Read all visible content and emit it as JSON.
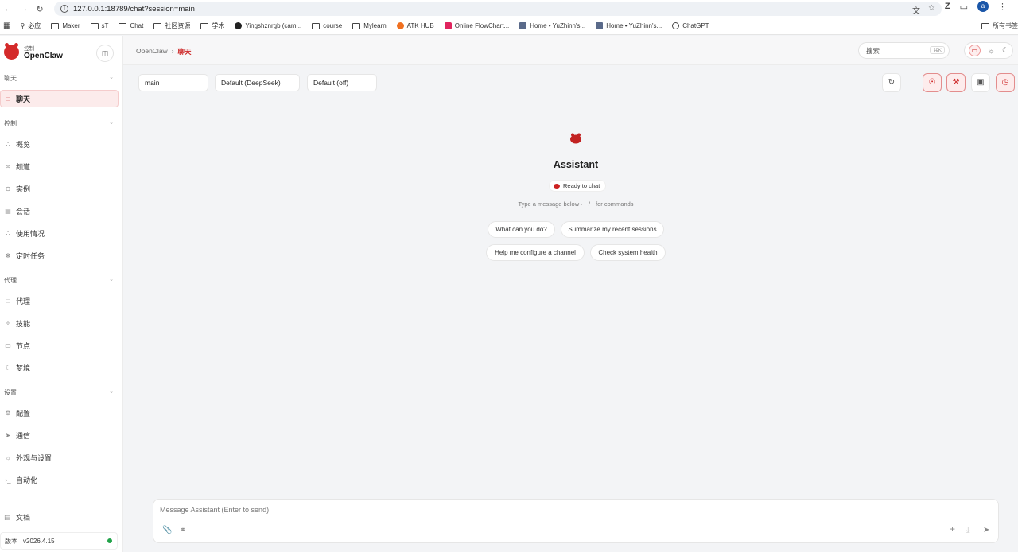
{
  "browser": {
    "url": "127.0.0.1:18789/chat?session=main",
    "bookmarks": [
      {
        "label": "必应",
        "icon": "search-icon"
      },
      {
        "label": "Maker",
        "icon": "folder-icon"
      },
      {
        "label": "sT",
        "icon": "folder-icon"
      },
      {
        "label": "Chat",
        "icon": "folder-icon"
      },
      {
        "label": "社区资源",
        "icon": "folder-icon"
      },
      {
        "label": "学术",
        "icon": "folder-icon"
      },
      {
        "label": "Yingshznrgb (cam...",
        "icon": "github-icon"
      },
      {
        "label": "course",
        "icon": "folder-icon"
      },
      {
        "label": "Mylearn",
        "icon": "folder-icon"
      },
      {
        "label": "ATK HUB",
        "icon": "atk-icon"
      },
      {
        "label": "Online FlowChart...",
        "icon": "flowchart-icon"
      },
      {
        "label": "Home • YuZhinn's...",
        "icon": "site-icon"
      },
      {
        "label": "Home • YuZhinn's...",
        "icon": "site-icon"
      },
      {
        "label": "ChatGPT",
        "icon": "chatgpt-icon"
      }
    ],
    "all_bookmarks": "所有书签",
    "profile_initial": "a"
  },
  "sidebar": {
    "brand_sub": "控制",
    "brand_name": "OpenClaw",
    "sections": {
      "chat": "聊天",
      "control": "控制",
      "agent": "代理",
      "settings": "设置"
    },
    "items": {
      "chat": "聊天",
      "overview": "概览",
      "channels": "频道",
      "instances": "实例",
      "sessions": "会话",
      "usage": "使用情况",
      "cron": "定时任务",
      "agents": "代理",
      "skills": "技能",
      "nodes": "节点",
      "dreams": "梦境",
      "config": "配置",
      "comms": "通信",
      "appearance": "外观与设置",
      "automation": "自动化"
    },
    "docs": "文档",
    "version_label": "版本",
    "version_value": "v2026.4.15"
  },
  "topbar": {
    "breadcrumb_root": "OpenClaw",
    "breadcrumb_current": "聊天",
    "search_placeholder": "搜索",
    "search_shortcut": "⌘K"
  },
  "chat": {
    "session": "main",
    "model": "Default (DeepSeek)",
    "thinking": "Default (off)",
    "assistant_name": "Assistant",
    "status": "Ready to chat",
    "hint_prefix": "Type a message below ·",
    "hint_slash": "/",
    "hint_suffix": "for commands",
    "suggestions": [
      "What can you do?",
      "Summarize my recent sessions",
      "Help me configure a channel",
      "Check system health"
    ],
    "composer_placeholder": "Message Assistant (Enter to send)"
  },
  "colors": {
    "accent": "#c22222",
    "status_online": "#22a34a"
  }
}
